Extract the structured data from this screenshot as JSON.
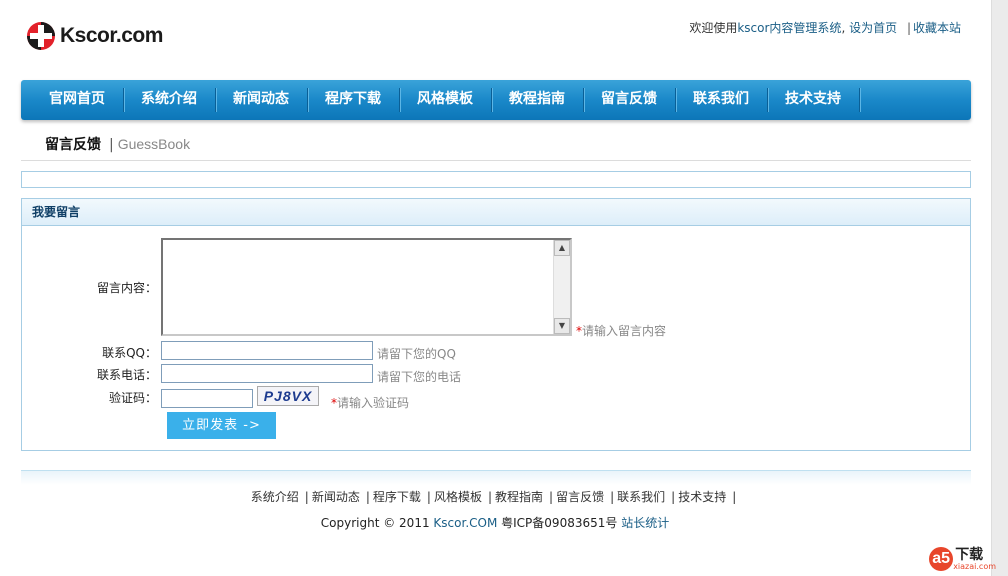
{
  "header": {
    "logo_text": "Kscor.com",
    "welcome_prefix": "欢迎使用",
    "welcome_link": "kscor内容管理系统",
    "comma": ",",
    "set_home": "设为首页",
    "separator": "|",
    "bookmark": "收藏本站"
  },
  "nav": {
    "items": [
      {
        "label": "官网首页"
      },
      {
        "label": "系统介绍"
      },
      {
        "label": "新闻动态"
      },
      {
        "label": "程序下载"
      },
      {
        "label": "风格模板"
      },
      {
        "label": "教程指南"
      },
      {
        "label": "留言反馈"
      },
      {
        "label": "联系我们"
      },
      {
        "label": "技术支持"
      }
    ]
  },
  "breadcrumb": {
    "title_cn": "留言反馈",
    "separator": "|",
    "title_en": "GuessBook"
  },
  "form": {
    "panel_title": "我要留言",
    "content_label": "留言内容：",
    "content_hint_star": "*",
    "content_hint": "请输入留言内容",
    "content_value": "",
    "qq_label": "联系QQ：",
    "qq_hint": "请留下您的QQ",
    "qq_value": "",
    "phone_label": "联系电话：",
    "phone_hint": "请留下您的电话",
    "phone_value": "",
    "captcha_label": "验证码：",
    "captcha_image_text": "PJ8VX",
    "captcha_hint_star": "*",
    "captcha_hint": "请输入验证码",
    "captcha_value": "",
    "submit_label": "立即发表 ->"
  },
  "footer": {
    "links": [
      {
        "label": "系统介绍"
      },
      {
        "label": "新闻动态"
      },
      {
        "label": "程序下载"
      },
      {
        "label": "风格模板"
      },
      {
        "label": "教程指南"
      },
      {
        "label": "留言反馈"
      },
      {
        "label": "联系我们"
      },
      {
        "label": "技术支持"
      }
    ],
    "separator": "|",
    "copyright_prefix": "Copyright © 2011",
    "copyright_site": "Kscor.COM",
    "icp": "粤ICP备09083651号",
    "stats": "站长统计"
  },
  "watermark": {
    "circle": "a5",
    "text": "下载",
    "sub": "xiazai.com"
  },
  "colors": {
    "nav_blue": "#1a88c9",
    "button_blue": "#3ab0ea",
    "link_blue": "#1a5e86",
    "required_red": "#dd0000"
  }
}
